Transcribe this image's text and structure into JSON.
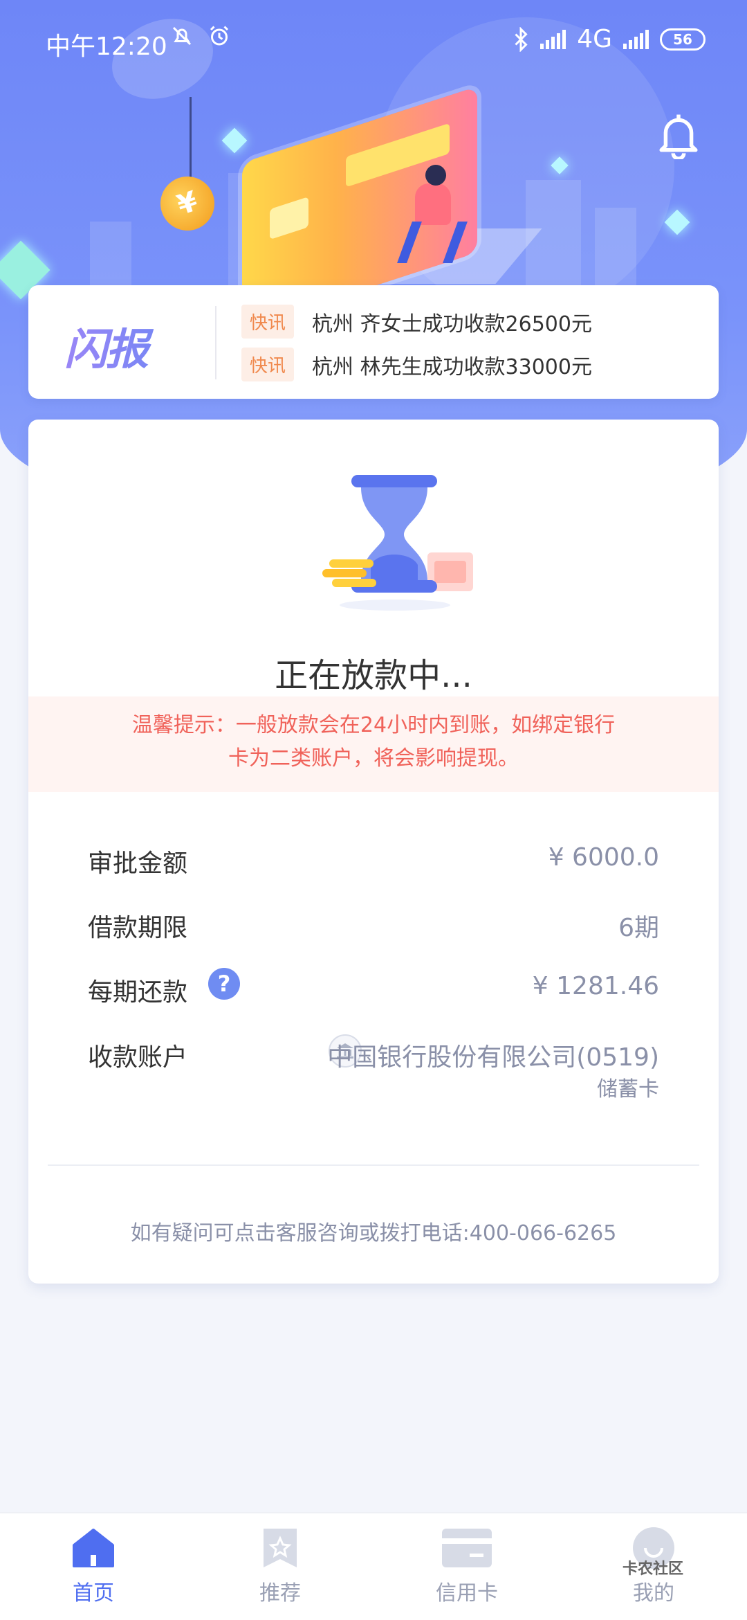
{
  "status_bar": {
    "time": "中午12:20",
    "network": "4G",
    "battery": "56"
  },
  "news": {
    "logo": "闪报",
    "items": [
      {
        "tag": "快讯",
        "text": "杭州 齐女士成功收款26500元"
      },
      {
        "tag": "快讯",
        "text": "杭州 林先生成功收款33000元"
      }
    ]
  },
  "loan": {
    "status_title": "正在放款中...",
    "tip_line1": "温馨提示：一般放款会在24小时内到账，如绑定银行",
    "tip_line2": "卡为二类账户，将会影响提现。",
    "rows": [
      {
        "label": "审批金额",
        "value": "¥ 6000.0"
      },
      {
        "label": "借款期限",
        "value": "6期"
      },
      {
        "label": "每期还款",
        "value": "¥ 1281.46"
      },
      {
        "label": "收款账户",
        "value": "中国银行股份有限公司(0519)",
        "sub": "储蓄卡"
      }
    ],
    "contact": "如有疑问可点击客服咨询或拨打电话:400-066-6265"
  },
  "nav": {
    "items": [
      {
        "label": "首页",
        "icon": "home-icon",
        "active": true
      },
      {
        "label": "推荐",
        "icon": "recommend-icon",
        "active": false
      },
      {
        "label": "信用卡",
        "icon": "credit-card-icon",
        "active": false
      },
      {
        "label": "我的",
        "icon": "profile-icon",
        "active": false
      }
    ]
  },
  "watermark": "卡农社区",
  "colors": {
    "accent": "#4f6ef0",
    "hero": "#7a93fa",
    "tip_text": "#f0625a",
    "tag_text": "#f0894d"
  }
}
